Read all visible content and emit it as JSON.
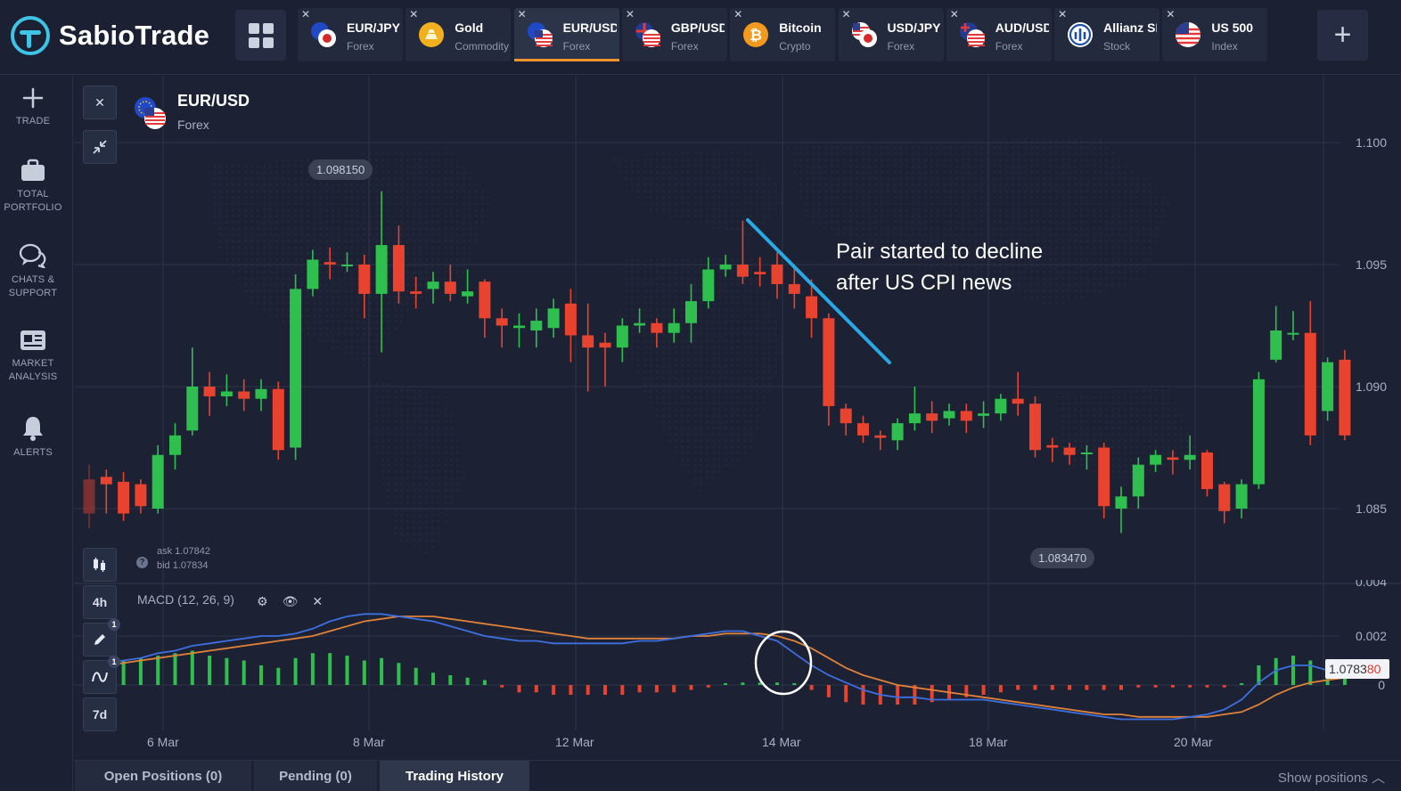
{
  "brand": {
    "name": "SabioTrade"
  },
  "tabs": [
    {
      "name": "EUR/JPY",
      "category": "Forex",
      "icon": "eur-jpy-flag-icon",
      "active": false
    },
    {
      "name": "Gold",
      "category": "Commodity",
      "icon": "gold-icon",
      "active": false
    },
    {
      "name": "EUR/USD",
      "category": "Forex",
      "icon": "eur-usd-flag-icon",
      "active": true
    },
    {
      "name": "GBP/USD",
      "category": "Forex",
      "icon": "gbp-usd-flag-icon",
      "active": false
    },
    {
      "name": "Bitcoin",
      "category": "Crypto",
      "icon": "bitcoin-icon",
      "active": false
    },
    {
      "name": "USD/JPY",
      "category": "Forex",
      "icon": "usd-jpy-flag-icon",
      "active": false
    },
    {
      "name": "AUD/USD",
      "category": "Forex",
      "icon": "aud-usd-flag-icon",
      "active": false
    },
    {
      "name": "Allianz SE",
      "category": "Stock",
      "icon": "allianz-icon",
      "active": false
    },
    {
      "name": "US 500",
      "category": "Index",
      "icon": "us-flag-icon",
      "active": false
    }
  ],
  "sidenav": {
    "trade": "TRADE",
    "portfolio_1": "TOTAL",
    "portfolio_2": "PORTFOLIO",
    "chats_1": "CHATS &",
    "chats_2": "SUPPORT",
    "analysis_1": "MARKET",
    "analysis_2": "ANALYSIS",
    "alerts": "ALERTS"
  },
  "instrument": {
    "name": "EUR/USD",
    "category": "Forex"
  },
  "price_tags": {
    "high": "1.098150",
    "low": "1.083470"
  },
  "quote": {
    "ask": "ask 1.07842",
    "bid": "bid 1.07834"
  },
  "timeframes": {
    "interval": "4h",
    "range": "7d"
  },
  "tool_badges": {
    "draw": "1",
    "indicators": "1"
  },
  "indicator": {
    "label": "MACD (12, 26, 9)"
  },
  "annotation": {
    "line1": "Pair started to decline",
    "line2": "after US CPI news"
  },
  "current_price": {
    "main": "1.0783",
    "highlight": "80"
  },
  "bottom_tabs": {
    "open": "Open Positions (0)",
    "pending": "Pending (0)",
    "history": "Trading History"
  },
  "show_positions": "Show positions",
  "colors": {
    "up": "#2fbf4f",
    "down": "#e8432f",
    "macd": "#3d6fe0",
    "signal": "#e0813a",
    "annotation_line": "#29a8e6",
    "accent": "#f0952c"
  },
  "chart_data": {
    "type": "candlestick",
    "price_axis": {
      "ticks": [
        "1.100",
        "1.095",
        "1.090",
        "1.085"
      ],
      "range": [
        1.0805,
        1.1015
      ]
    },
    "x_labels": [
      "6 Mar",
      "8 Mar",
      "12 Mar",
      "14 Mar",
      "18 Mar",
      "20 Mar"
    ],
    "macd_axis": {
      "ticks": [
        "0.004",
        "0.002",
        "0"
      ]
    },
    "candles": [
      [
        1.0862,
        1.0848,
        1.0868,
        1.0842
      ],
      [
        1.0863,
        1.086,
        1.0866,
        1.0848
      ],
      [
        1.0861,
        1.0848,
        1.0865,
        1.0845
      ],
      [
        1.086,
        1.0851,
        1.0862,
        1.0848
      ],
      [
        1.085,
        1.0872,
        1.0876,
        1.0848
      ],
      [
        1.0872,
        1.088,
        1.0885,
        1.0866
      ],
      [
        1.0882,
        1.09,
        1.0916,
        1.088
      ],
      [
        1.09,
        1.0896,
        1.0906,
        1.0888
      ],
      [
        1.0896,
        1.0898,
        1.0905,
        1.0892
      ],
      [
        1.0898,
        1.0895,
        1.0903,
        1.089
      ],
      [
        1.0895,
        1.0899,
        1.0903,
        1.089
      ],
      [
        1.0899,
        1.0874,
        1.0902,
        1.087
      ],
      [
        1.0875,
        1.094,
        1.0946,
        1.087
      ],
      [
        1.094,
        1.0952,
        1.0956,
        1.0937
      ],
      [
        1.0951,
        1.095,
        1.0957,
        1.0944
      ],
      [
        1.095,
        1.095,
        1.0955,
        1.0947
      ],
      [
        1.095,
        1.0938,
        1.0954,
        1.0928
      ],
      [
        1.0938,
        1.0958,
        1.098,
        1.0914
      ],
      [
        1.0958,
        1.0939,
        1.0966,
        1.0934
      ],
      [
        1.0939,
        1.0938,
        1.0945,
        1.0932
      ],
      [
        1.094,
        1.0943,
        1.0947,
        1.0934
      ],
      [
        1.0943,
        1.0938,
        1.095,
        1.0935
      ],
      [
        1.0937,
        1.0939,
        1.0948,
        1.0934
      ],
      [
        1.0943,
        1.0928,
        1.0944,
        1.092
      ],
      [
        1.0928,
        1.0925,
        1.0932,
        1.0916
      ],
      [
        1.0924,
        1.0925,
        1.093,
        1.0916
      ],
      [
        1.0923,
        1.0927,
        1.0932,
        1.0916
      ],
      [
        1.0924,
        1.0932,
        1.0936,
        1.092
      ],
      [
        1.0934,
        1.0921,
        1.094,
        1.091
      ],
      [
        1.0921,
        1.0916,
        1.0934,
        1.0898
      ],
      [
        1.0918,
        1.0916,
        1.0922,
        1.09
      ],
      [
        1.0916,
        1.0925,
        1.0928,
        1.091
      ],
      [
        1.0925,
        1.0926,
        1.0932,
        1.0922
      ],
      [
        1.0926,
        1.0922,
        1.0928,
        1.0916
      ],
      [
        1.0922,
        1.0926,
        1.0932,
        1.0918
      ],
      [
        1.0926,
        1.0935,
        1.0942,
        1.0918
      ],
      [
        1.0935,
        1.0948,
        1.0953,
        1.0932
      ],
      [
        1.0948,
        1.095,
        1.0954,
        1.0945
      ],
      [
        1.095,
        1.0945,
        1.0968,
        1.0942
      ],
      [
        1.0947,
        1.0946,
        1.0953,
        1.0941
      ],
      [
        1.095,
        1.0942,
        1.0955,
        1.0936
      ],
      [
        1.0942,
        1.0938,
        1.095,
        1.0932
      ],
      [
        1.0937,
        1.0928,
        1.0944,
        1.092
      ],
      [
        1.0928,
        1.0892,
        1.093,
        1.0884
      ],
      [
        1.0891,
        1.0885,
        1.0893,
        1.088
      ],
      [
        1.0885,
        1.088,
        1.0888,
        1.0877
      ],
      [
        1.088,
        1.0879,
        1.0882,
        1.0874
      ],
      [
        1.0878,
        1.0885,
        1.0887,
        1.0874
      ],
      [
        1.0885,
        1.0889,
        1.09,
        1.0882
      ],
      [
        1.0889,
        1.0886,
        1.0894,
        1.0881
      ],
      [
        1.0887,
        1.089,
        1.0893,
        1.0884
      ],
      [
        1.089,
        1.0886,
        1.0893,
        1.0881
      ],
      [
        1.0888,
        1.0889,
        1.0894,
        1.0883
      ],
      [
        1.0889,
        1.0895,
        1.0897,
        1.0886
      ],
      [
        1.0895,
        1.0893,
        1.0906,
        1.0888
      ],
      [
        1.0893,
        1.0874,
        1.0896,
        1.0871
      ],
      [
        1.0876,
        1.0875,
        1.0879,
        1.0869
      ],
      [
        1.0875,
        1.0872,
        1.0877,
        1.0868
      ],
      [
        1.0873,
        1.0873,
        1.0876,
        1.0866
      ],
      [
        1.0875,
        1.0851,
        1.0877,
        1.0846
      ],
      [
        1.085,
        1.0855,
        1.0859,
        1.084
      ],
      [
        1.0855,
        1.0868,
        1.0871,
        1.085
      ],
      [
        1.0868,
        1.0872,
        1.0874,
        1.0865
      ],
      [
        1.0871,
        1.087,
        1.0874,
        1.0864
      ],
      [
        1.087,
        1.0872,
        1.088,
        1.0866
      ],
      [
        1.0873,
        1.0858,
        1.0874,
        1.0855
      ],
      [
        1.086,
        1.0849,
        1.0861,
        1.0844
      ],
      [
        1.085,
        1.086,
        1.0862,
        1.0846
      ],
      [
        1.086,
        1.0903,
        1.0906,
        1.0858
      ],
      [
        1.0911,
        1.0923,
        1.0933,
        1.091
      ],
      [
        1.0922,
        1.0922,
        1.0931,
        1.0919
      ],
      [
        1.0922,
        1.088,
        1.0935,
        1.0876
      ],
      [
        1.089,
        1.091,
        1.0912,
        1.0886
      ],
      [
        1.0911,
        1.088,
        1.0915,
        1.0878
      ]
    ],
    "macd_hist": [
      0.0008,
      0.0009,
      0.001,
      0.0011,
      0.0012,
      0.0013,
      0.0014,
      0.0012,
      0.0011,
      0.001,
      0.0008,
      0.0007,
      0.0011,
      0.0013,
      0.0013,
      0.0012,
      0.001,
      0.0011,
      0.0009,
      0.0007,
      0.0005,
      0.0004,
      0.0003,
      0.0002,
      -0.0001,
      -0.0003,
      -0.0003,
      -0.0004,
      -0.0004,
      -0.0004,
      -0.0004,
      -0.0004,
      -0.0003,
      -0.0003,
      -0.0003,
      -0.0002,
      -0.0001,
      0.0,
      0.0001,
      0.0001,
      0.0001,
      0.0,
      -0.0002,
      -0.0005,
      -0.0007,
      -0.0008,
      -0.0008,
      -0.0008,
      -0.0008,
      -0.0007,
      -0.0006,
      -0.0005,
      -0.0004,
      -0.0003,
      -0.0002,
      -0.0002,
      -0.0002,
      -0.0002,
      -0.0002,
      -0.0002,
      -0.0002,
      -0.0001,
      -0.0001,
      -0.0001,
      -0.0001,
      -0.0001,
      -0.0001,
      0.0,
      0.0008,
      0.0011,
      0.0012,
      0.001,
      0.0009,
      0.0007
    ],
    "macd_line": [
      0.0008,
      0.0009,
      0.001,
      0.0011,
      0.0013,
      0.0014,
      0.0016,
      0.0017,
      0.0018,
      0.0019,
      0.002,
      0.002,
      0.0021,
      0.0023,
      0.0026,
      0.0028,
      0.0029,
      0.0029,
      0.0028,
      0.0027,
      0.0026,
      0.0024,
      0.0022,
      0.002,
      0.0019,
      0.0018,
      0.0018,
      0.0017,
      0.0017,
      0.0017,
      0.0017,
      0.0017,
      0.0018,
      0.0018,
      0.0019,
      0.002,
      0.0021,
      0.0022,
      0.0022,
      0.002,
      0.0018,
      0.0013,
      0.0008,
      0.0004,
      0.0001,
      -0.0002,
      -0.0004,
      -0.0005,
      -0.0005,
      -0.0006,
      -0.0006,
      -0.0006,
      -0.0006,
      -0.0007,
      -0.0008,
      -0.0009,
      -0.001,
      -0.0011,
      -0.0012,
      -0.0013,
      -0.0014,
      -0.0014,
      -0.0014,
      -0.0014,
      -0.0013,
      -0.0012,
      -0.001,
      -0.0006,
      0.0001,
      0.0006,
      0.0008,
      0.0008,
      0.0006,
      0.0004
    ],
    "signal_line": [
      0.0008,
      0.0008,
      0.0009,
      0.001,
      0.0011,
      0.0012,
      0.0013,
      0.0014,
      0.0015,
      0.0016,
      0.0017,
      0.0018,
      0.0019,
      0.002,
      0.0022,
      0.0024,
      0.0026,
      0.0027,
      0.0028,
      0.0028,
      0.0028,
      0.0027,
      0.0026,
      0.0025,
      0.0024,
      0.0023,
      0.0022,
      0.0021,
      0.002,
      0.0019,
      0.0019,
      0.0019,
      0.0019,
      0.0019,
      0.0019,
      0.002,
      0.002,
      0.0021,
      0.0021,
      0.0021,
      0.002,
      0.0018,
      0.0015,
      0.0011,
      0.0007,
      0.0004,
      0.0002,
      0.0,
      -0.0001,
      -0.0002,
      -0.0003,
      -0.0004,
      -0.0005,
      -0.0006,
      -0.0007,
      -0.0008,
      -0.0009,
      -0.001,
      -0.0011,
      -0.0012,
      -0.0012,
      -0.0013,
      -0.0013,
      -0.0013,
      -0.0013,
      -0.0013,
      -0.0012,
      -0.0011,
      -0.0008,
      -0.0004,
      -0.0001,
      0.0001,
      0.0002,
      0.0003
    ]
  }
}
